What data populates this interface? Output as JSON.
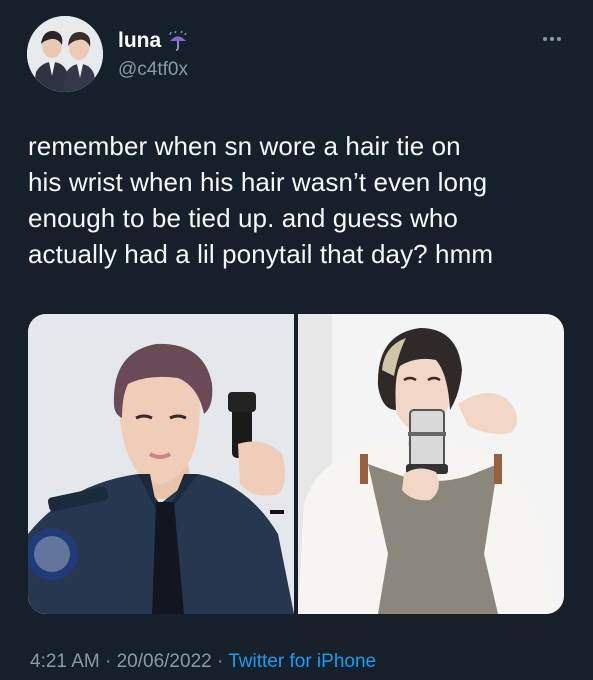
{
  "user": {
    "display_name": "luna",
    "handle": "@c4tf0x",
    "name_emoji_icon": "umbrella-with-rain-icon"
  },
  "tweet": {
    "text_lines": [
      "remember when sn wore a hair tie on",
      "his wrist when his hair wasn’t even long",
      "enough to be tied up. and guess who",
      "actually had a lil ponytail that day? hmm"
    ],
    "time": "4:21 AM",
    "separator": "·",
    "date": "20/06/2022",
    "source": "Twitter for iPhone"
  },
  "photos": [
    {
      "name": "photo-police-uniform"
    },
    {
      "name": "photo-white-sweater"
    }
  ],
  "colors": {
    "background": "#15202b",
    "text": "#f7f9f9",
    "secondary_text": "#8b98a5",
    "link": "#1d9bf0"
  }
}
